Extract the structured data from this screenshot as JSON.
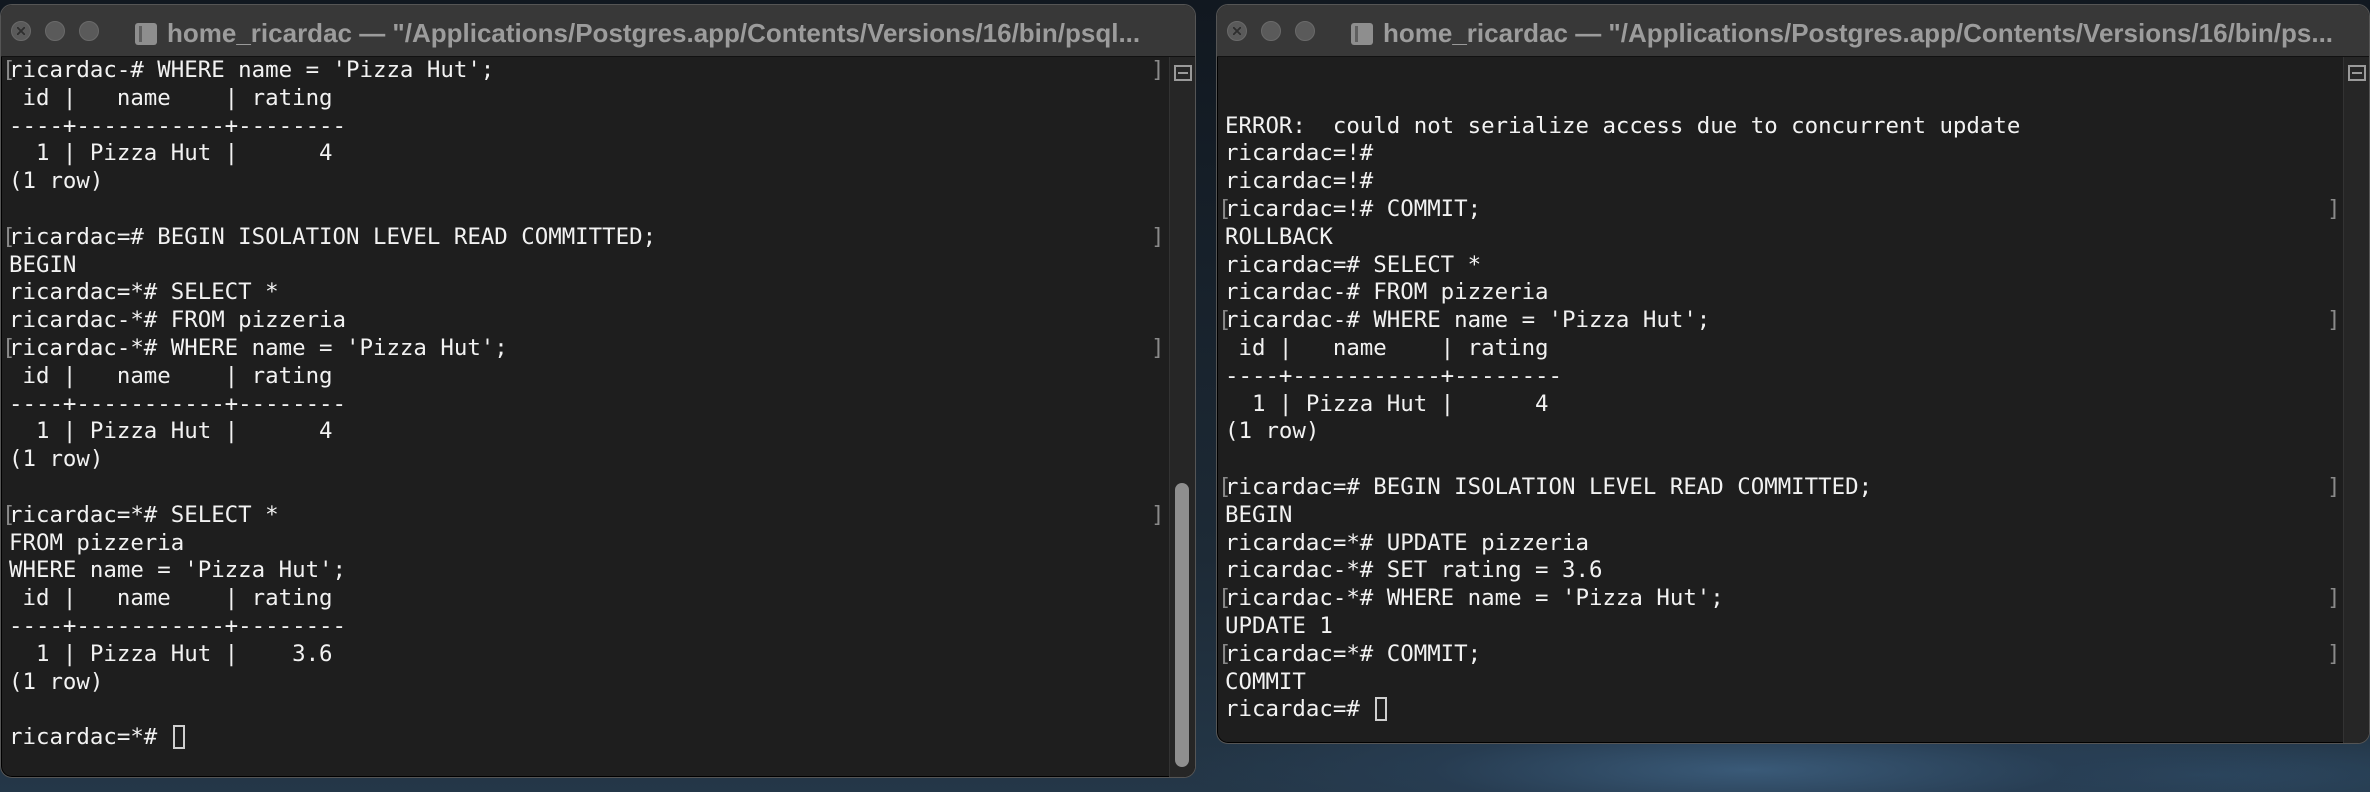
{
  "left_window": {
    "title": "home_ricardac — \"/Applications/Postgres.app/Contents/Versions/16/bin/psql...",
    "lines": [
      {
        "text": "ricardac-# WHERE name = 'Pizza Hut';",
        "bracketed": true
      },
      {
        "text": " id |   name    | rating"
      },
      {
        "text": "----+-----------+--------"
      },
      {
        "text": "  1 | Pizza Hut |      4"
      },
      {
        "text": "(1 row)"
      },
      {
        "text": ""
      },
      {
        "text": "ricardac=# BEGIN ISOLATION LEVEL READ COMMITTED;",
        "bracketed": true
      },
      {
        "text": "BEGIN"
      },
      {
        "text": "ricardac=*# SELECT *"
      },
      {
        "text": "ricardac-*# FROM pizzeria"
      },
      {
        "text": "ricardac-*# WHERE name = 'Pizza Hut';",
        "bracketed": true
      },
      {
        "text": " id |   name    | rating"
      },
      {
        "text": "----+-----------+--------"
      },
      {
        "text": "  1 | Pizza Hut |      4"
      },
      {
        "text": "(1 row)"
      },
      {
        "text": ""
      },
      {
        "text": "ricardac=*# SELECT *",
        "bracketed": true
      },
      {
        "text": "FROM pizzeria"
      },
      {
        "text": "WHERE name = 'Pizza Hut';"
      },
      {
        "text": " id |   name    | rating"
      },
      {
        "text": "----+-----------+--------"
      },
      {
        "text": "  1 | Pizza Hut |    3.6"
      },
      {
        "text": "(1 row)"
      },
      {
        "text": ""
      },
      {
        "text": "ricardac=*# ",
        "cursor": true
      }
    ]
  },
  "right_window": {
    "title": "home_ricardac — \"/Applications/Postgres.app/Contents/Versions/16/bin/ps...",
    "lines": [
      {
        "text": ""
      },
      {
        "text": ""
      },
      {
        "text": "ERROR:  could not serialize access due to concurrent update"
      },
      {
        "text": "ricardac=!#"
      },
      {
        "text": "ricardac=!#"
      },
      {
        "text": "ricardac=!# COMMIT;",
        "bracketed": true
      },
      {
        "text": "ROLLBACK"
      },
      {
        "text": "ricardac=# SELECT *"
      },
      {
        "text": "ricardac-# FROM pizzeria"
      },
      {
        "text": "ricardac-# WHERE name = 'Pizza Hut';",
        "bracketed": true
      },
      {
        "text": " id |   name    | rating"
      },
      {
        "text": "----+-----------+--------"
      },
      {
        "text": "  1 | Pizza Hut |      4"
      },
      {
        "text": "(1 row)"
      },
      {
        "text": ""
      },
      {
        "text": "ricardac=# BEGIN ISOLATION LEVEL READ COMMITTED;",
        "bracketed": true
      },
      {
        "text": "BEGIN"
      },
      {
        "text": "ricardac=*# UPDATE pizzeria"
      },
      {
        "text": "ricardac-*# SET rating = 3.6"
      },
      {
        "text": "ricardac-*# WHERE name = 'Pizza Hut';",
        "bracketed": true
      },
      {
        "text": "UPDATE 1"
      },
      {
        "text": "ricardac=*# COMMIT;",
        "bracketed": true
      },
      {
        "text": "COMMIT"
      },
      {
        "text": "ricardac=# ",
        "cursor": true
      }
    ]
  }
}
